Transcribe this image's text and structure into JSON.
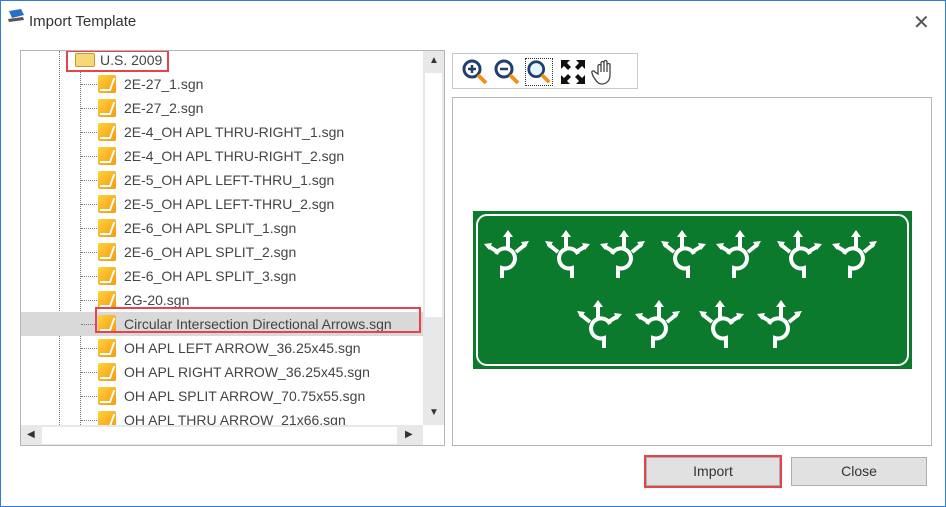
{
  "window": {
    "title": "Import Template"
  },
  "tree": {
    "folder": "U.S. 2009",
    "items": [
      "2E-27_1.sgn",
      "2E-27_2.sgn",
      "2E-4_OH APL THRU-RIGHT_1.sgn",
      "2E-4_OH APL THRU-RIGHT_2.sgn",
      "2E-5_OH APL LEFT-THRU_1.sgn",
      "2E-5_OH APL LEFT-THRU_2.sgn",
      "2E-6_OH APL SPLIT_1.sgn",
      "2E-6_OH APL SPLIT_2.sgn",
      "2E-6_OH APL SPLIT_3.sgn",
      "2G-20.sgn",
      "Circular Intersection Directional Arrows.sgn",
      "OH APL LEFT ARROW_36.25x45.sgn",
      "OH APL RIGHT ARROW_36.25x45.sgn",
      "OH APL SPLIT ARROW_70.75x55.sgn",
      "OH APL THRU ARROW_21x66.sgn"
    ],
    "selected_index": 10
  },
  "toolbar": {
    "tools": [
      "zoom-in",
      "zoom-out",
      "zoom-window",
      "fit",
      "pan"
    ]
  },
  "preview": {
    "sign_color": "#0b7a2c",
    "top_row_symbols": 7,
    "bottom_row_symbols": 4
  },
  "buttons": {
    "import": "Import",
    "close": "Close"
  },
  "colors": {
    "highlight": "#e8424a",
    "accent": "#2b7fd6"
  }
}
